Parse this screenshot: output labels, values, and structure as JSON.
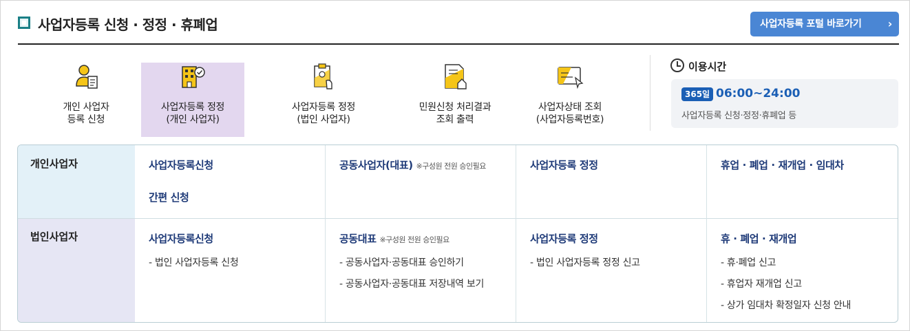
{
  "header": {
    "title": "사업자등록 신청 · 정정 · 휴폐업",
    "portal_button": "사업자등록 포털 바로가기",
    "accent_color": "#4a86d4"
  },
  "quick_menu": [
    {
      "line1": "개인 사업자",
      "line2": "등록 신청",
      "icon": "person-document-icon"
    },
    {
      "line1": "사업자등록 정정",
      "line2": "(개인 사업자)",
      "icon": "building-check-icon",
      "active": true
    },
    {
      "line1": "사업자등록 정정",
      "line2": "(법인 사업자)",
      "icon": "clipboard-hand-icon"
    },
    {
      "line1": "민원신청 처리결과",
      "line2": "조회 출력",
      "icon": "document-house-icon"
    },
    {
      "line1": "사업자상태 조회",
      "line2": "(사업자등록번호)",
      "icon": "card-cursor-icon"
    }
  ],
  "service_time": {
    "title": "이용시간",
    "badge": "365일",
    "hours": "06:00~24:00",
    "desc": "사업자등록 신청·정정·휴폐업 등"
  },
  "table": {
    "individual": {
      "label": "개인사업자",
      "c1_link1": "사업자등록신청",
      "c1_link2": "간편 신청",
      "c2_link": "공동사업자(대표)",
      "c2_note": "※구성원 전원 승인필요",
      "c3_link": "사업자등록 정정",
      "c4_link": "휴업 · 폐업 · 재개업 · 임대차"
    },
    "corporate": {
      "label": "법인사업자",
      "c1_link": "사업자등록신청",
      "c1_sub1": "법인 사업자등록 신청",
      "c2_link": "공동대표",
      "c2_note": "※구성원 전원 승인필요",
      "c2_sub1": "공동사업자·공동대표 승인하기",
      "c2_sub2": "공동사업자·공동대표 저장내역 보기",
      "c3_link": "사업자등록 정정",
      "c3_sub1": "법인 사업자등록 정정 신고",
      "c4_link": "휴 · 폐업 · 재개업",
      "c4_sub1": "휴·폐업 신고",
      "c4_sub2": "휴업자 재개업 신고",
      "c4_sub3": "상가 임대차 확정일자 신청 안내"
    }
  }
}
